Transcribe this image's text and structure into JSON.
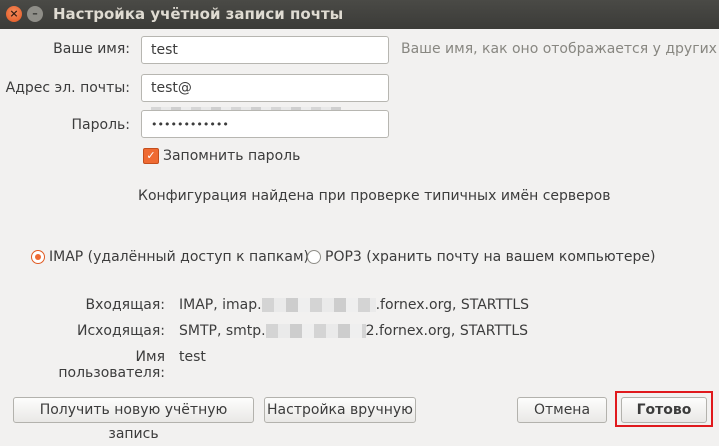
{
  "window": {
    "title": "Настройка учётной записи почты",
    "close_glyph": "×",
    "minimize_glyph": "–"
  },
  "form": {
    "name_label": "Ваше имя:",
    "name_value": "test",
    "name_hint": "Ваше имя, как оно отображается у других",
    "email_label": "Адрес эл. почты:",
    "email_value": "test@",
    "password_label": "Пароль:",
    "password_value": "••••••••••••",
    "remember_label": "Запомнить пароль",
    "remember_checked": true,
    "check_glyph": "✓"
  },
  "status": {
    "message": "Конфигурация найдена при проверке типичных имён серверов"
  },
  "protocol": {
    "imap_label": "IMAP (удалённый доступ к папкам)",
    "pop3_label": "POP3 (хранить почту на вашем компьютере)",
    "selected": "IMAP"
  },
  "server": {
    "incoming_label": "Входящая:",
    "incoming_prefix": "IMAP, imap.",
    "incoming_suffix": ".fornex.org, STARTTLS",
    "outgoing_label": "Исходящая:",
    "outgoing_prefix": "SMTP, smtp.",
    "outgoing_suffix": "2.fornex.org, STARTTLS",
    "username_label": "Имя пользователя:",
    "username_value": "test"
  },
  "buttons": {
    "new_account": "Получить новую учётную запись",
    "manual": "Настройка вручную",
    "cancel": "Отмена",
    "done": "Готово"
  },
  "colors": {
    "accent": "#ef6a32",
    "highlight_box": "#e0191d",
    "titlebar": "#3c3c3a"
  }
}
